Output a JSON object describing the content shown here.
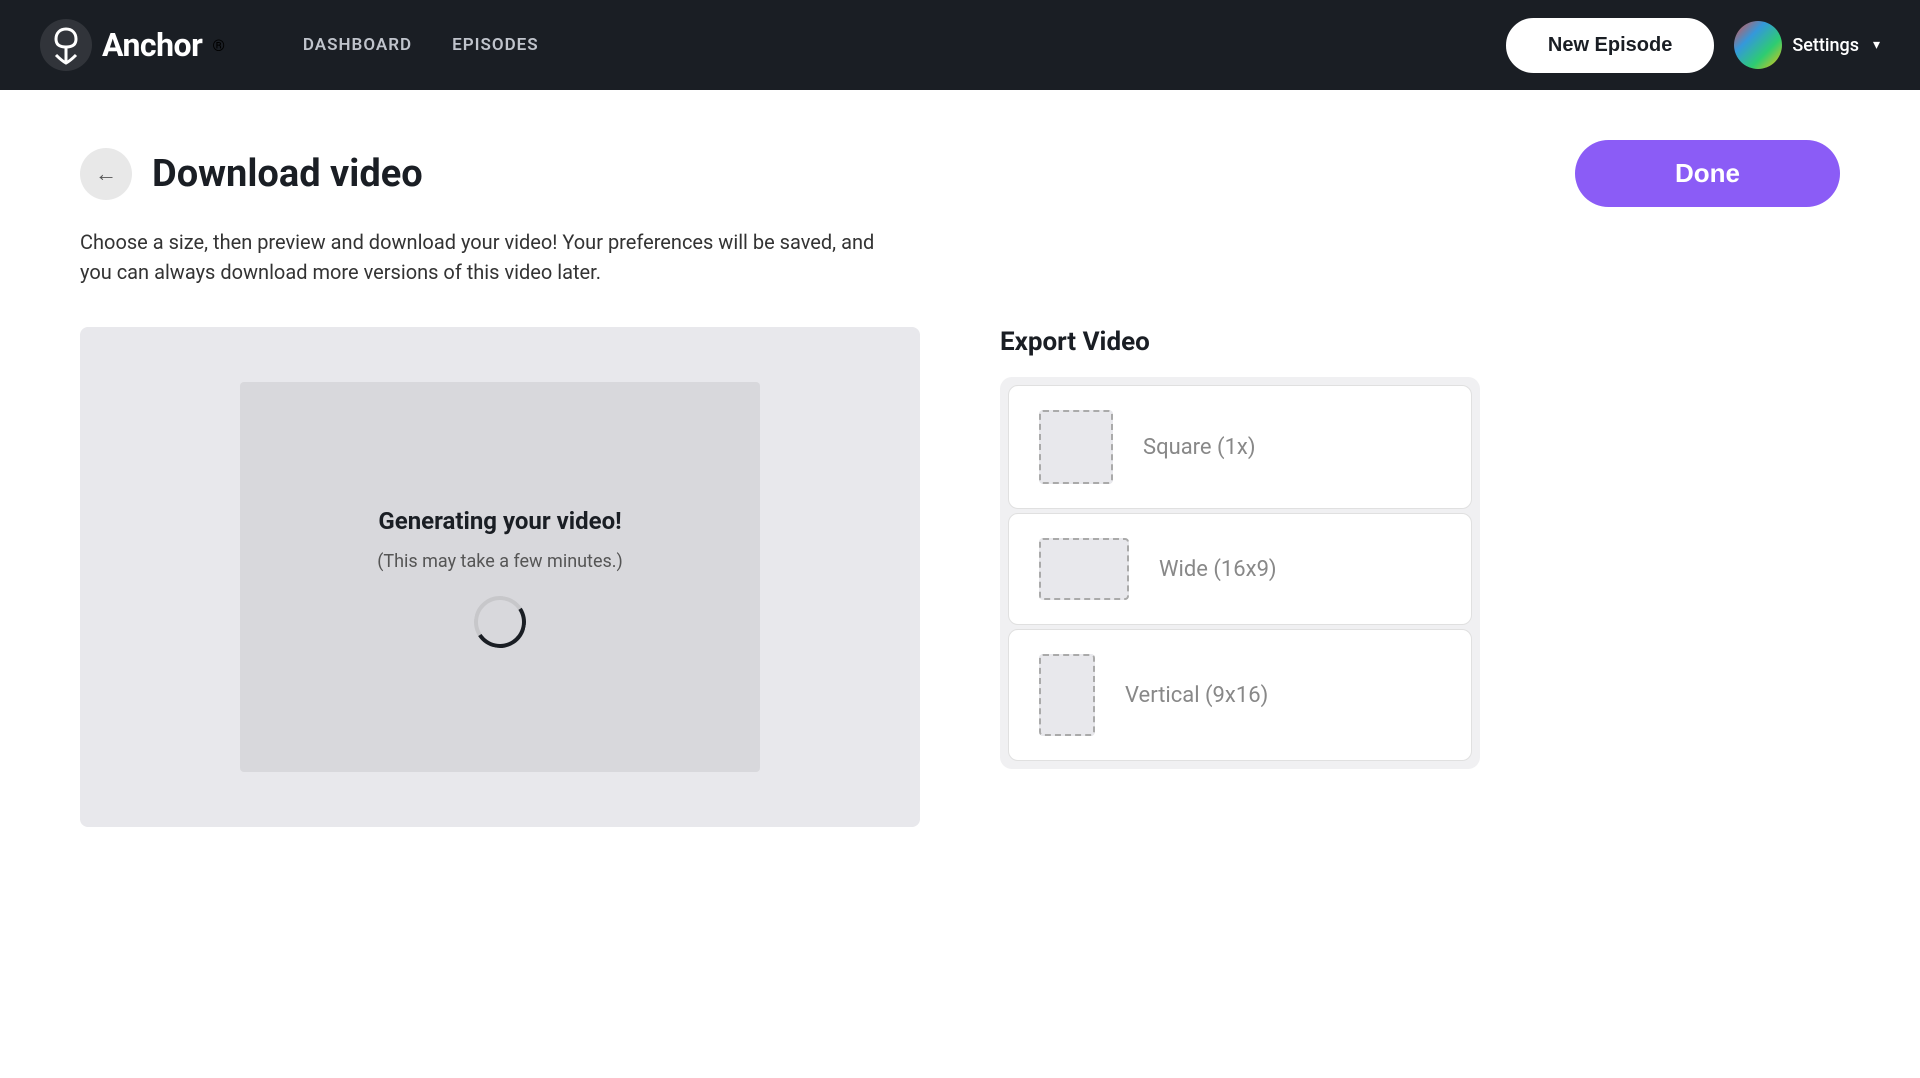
{
  "navbar": {
    "logo_text": "Anchor",
    "logo_reg": "®",
    "nav_items": [
      {
        "id": "dashboard",
        "label": "DASHBOARD"
      },
      {
        "id": "episodes",
        "label": "EPISODES"
      }
    ],
    "new_episode_label": "New Episode",
    "settings_label": "Settings"
  },
  "page": {
    "title": "Download video",
    "description": "Choose a size, then preview and download your video! Your preferences will be saved, and you can always download more versions of this video later.",
    "done_label": "Done",
    "back_label": "←"
  },
  "video_preview": {
    "generating_text": "Generating your video!",
    "generating_sub": "(This may take a few minutes.)"
  },
  "export": {
    "title": "Export Video",
    "options": [
      {
        "id": "square",
        "label": "Square (1x)",
        "shape": "square"
      },
      {
        "id": "wide",
        "label": "Wide (16x9)",
        "shape": "wide"
      },
      {
        "id": "vertical",
        "label": "Vertical (9x16)",
        "shape": "tall"
      }
    ]
  },
  "colors": {
    "done_btn": "#8b5cf6",
    "navbar_bg": "#1a1e24"
  }
}
